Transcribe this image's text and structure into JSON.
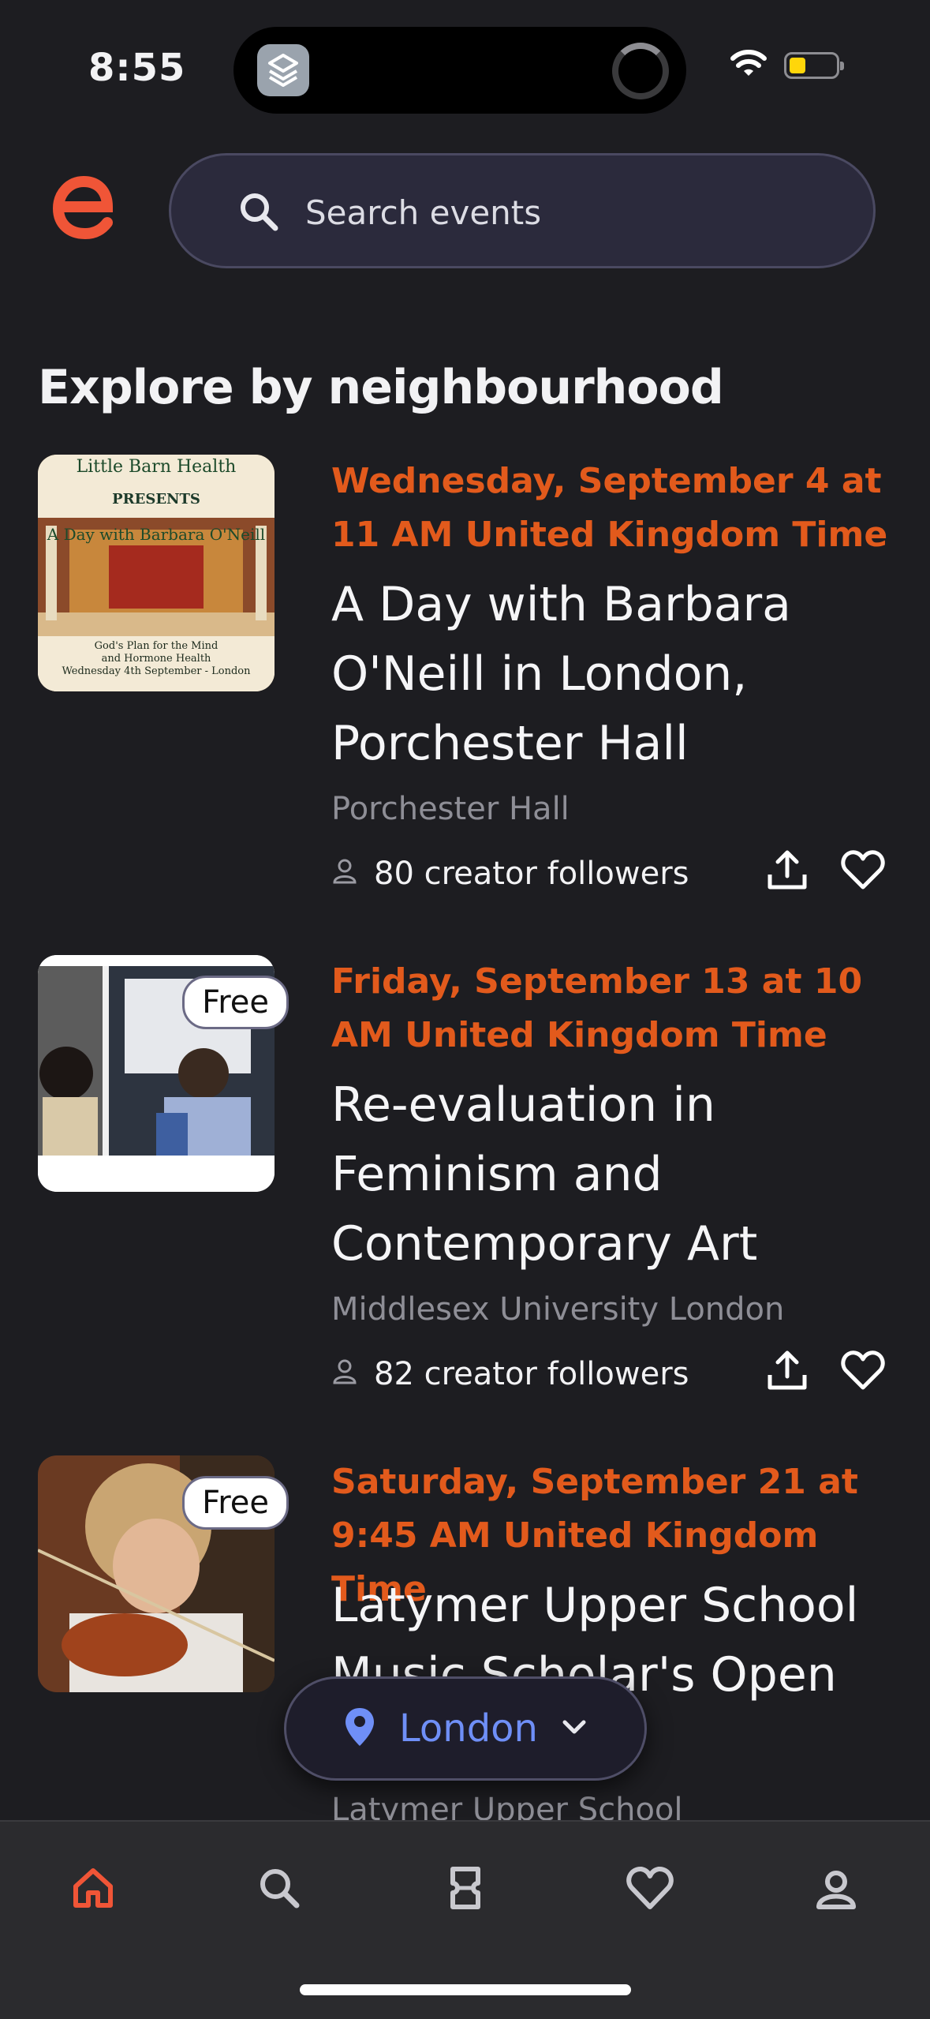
{
  "status_bar": {
    "time": "8:55"
  },
  "search": {
    "placeholder": "Search events"
  },
  "section": {
    "title": "Explore by neighbourhood"
  },
  "events": [
    {
      "date": "Wednesday, September 4 at 11 AM United Kingdom Time",
      "title": "A Day with Barbara O'Neill in London, Porchester Hall",
      "venue": "Porchester Hall",
      "followers": "80 creator followers",
      "thumb": {
        "org": "Little Barn Health",
        "presents": "PRESENTS",
        "headline": "A Day with Barbara O'Neill",
        "line1": "God's Plan for the Mind",
        "line2": "and Hormone Health",
        "line3": "Wednesday 4th September - London"
      }
    },
    {
      "date": "Friday, September 13 at 10 AM United Kingdom Time",
      "title": "Re-evaluation in Feminism and Contemporary Art",
      "venue": "Middlesex University London",
      "followers": "82 creator followers",
      "badge": "Free"
    },
    {
      "date": "Saturday, September 21 at 9:45 AM United Kingdom Time",
      "title": "Latymer Upper School Music Scholar's Open",
      "venue": "Latymer Upper School",
      "badge": "Free"
    }
  ],
  "location": {
    "label": "London"
  },
  "colors": {
    "accent": "#e25a1c",
    "location_text": "#6f8ff7",
    "background": "#1d1d21"
  },
  "tabs": [
    {
      "icon": "home-icon",
      "active": true
    },
    {
      "icon": "search-icon"
    },
    {
      "icon": "ticket-icon"
    },
    {
      "icon": "heart-icon"
    },
    {
      "icon": "profile-icon"
    }
  ]
}
